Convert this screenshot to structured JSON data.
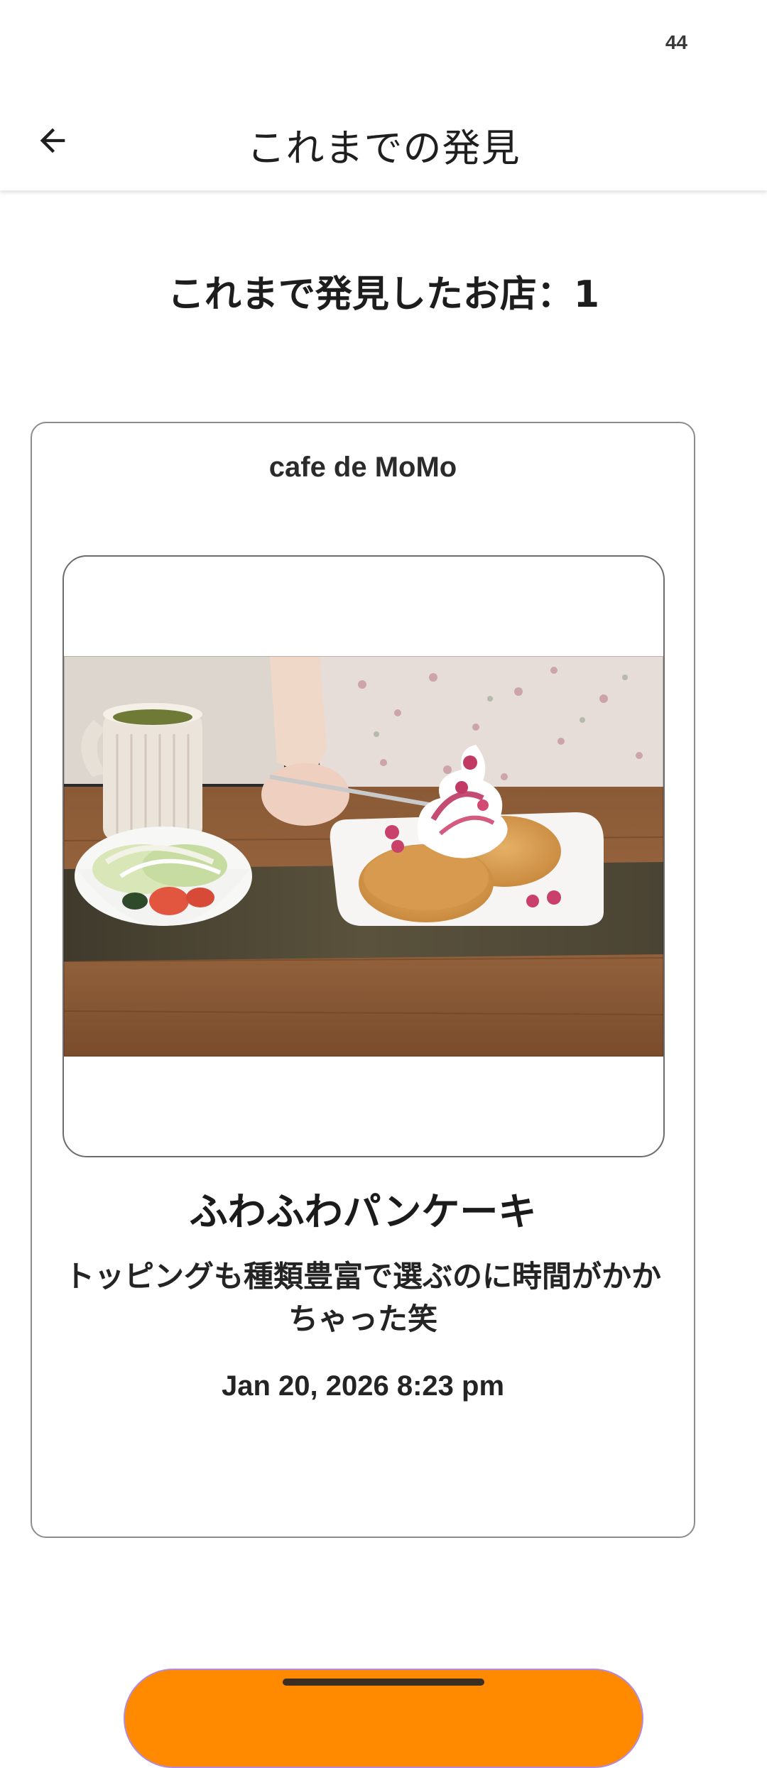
{
  "status_bar": {
    "battery": "44"
  },
  "app_bar": {
    "title": "これまでの発見",
    "back_icon": "arrow-left-icon"
  },
  "summary": {
    "heading": "これまで発見したお店：1"
  },
  "discoveries": [
    {
      "shop_name": "cafe de MoMo",
      "photo_description_icon": "food-photo",
      "menu_name": "ふわふわパンケーキ",
      "comment_line1": "トッピングも種類豊富で選ぶのに時間がかか",
      "comment_line2": "ちゃった笑",
      "date": "Jan 20, 2026 8:23 pm"
    }
  ],
  "colors": {
    "accent": "#ff8a00",
    "card_border": "#8c8c8c"
  }
}
